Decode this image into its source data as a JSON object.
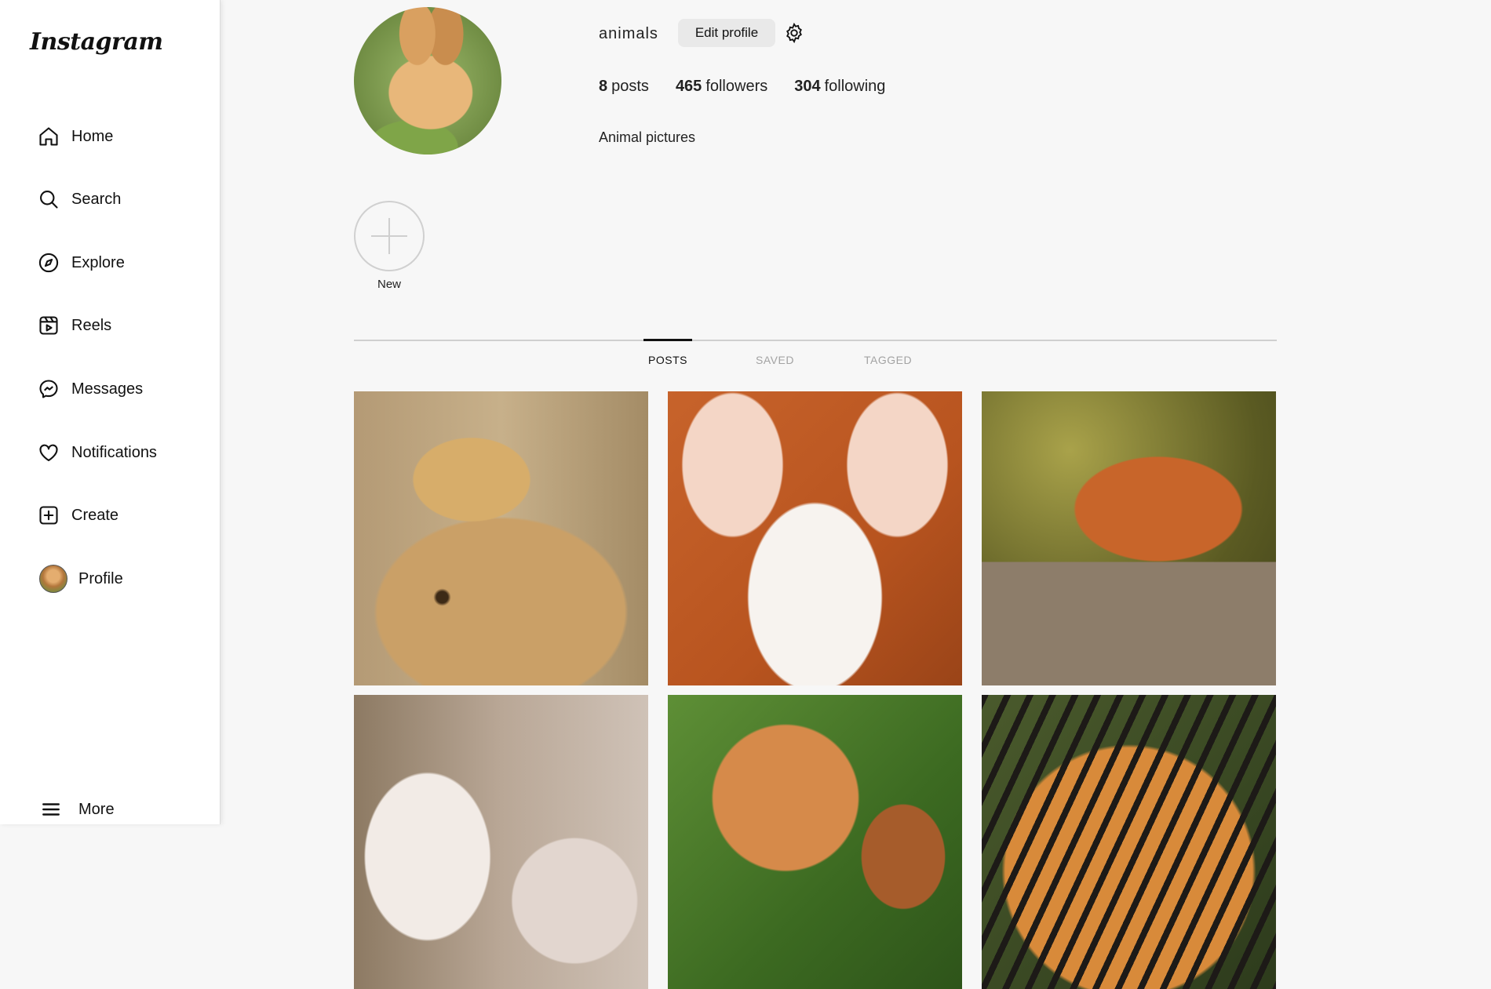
{
  "app": {
    "logo_text": "Instagram"
  },
  "sidebar": {
    "items": [
      {
        "label": "Home",
        "icon": "home-icon"
      },
      {
        "label": "Search",
        "icon": "search-icon"
      },
      {
        "label": "Explore",
        "icon": "compass-icon"
      },
      {
        "label": "Reels",
        "icon": "reels-icon"
      },
      {
        "label": "Messages",
        "icon": "messenger-icon"
      },
      {
        "label": "Notifications",
        "icon": "heart-icon"
      },
      {
        "label": "Create",
        "icon": "plus-square-icon"
      },
      {
        "label": "Profile",
        "icon": "avatar"
      }
    ],
    "more_label": "More"
  },
  "profile": {
    "username": "animals",
    "edit_button": "Edit profile",
    "stats": {
      "posts_count": "8",
      "posts_label": "posts",
      "followers_count": "465",
      "followers_label": "followers",
      "following_count": "304",
      "following_label": "following"
    },
    "bio": "Animal pictures",
    "new_story_label": "New"
  },
  "tabs": [
    {
      "label": "POSTS",
      "active": true
    },
    {
      "label": "SAVED",
      "active": false
    },
    {
      "label": "TAGGED",
      "active": false
    }
  ],
  "posts": [
    "cheetah",
    "fennec fox",
    "sleeping fox",
    "lamb",
    "squirrel",
    "tiger"
  ],
  "colors": {
    "background": "#f7f7f7",
    "sidebar": "#ffffff",
    "button": "#e9e9e9",
    "inactive_tab": "#a3a3a3"
  }
}
